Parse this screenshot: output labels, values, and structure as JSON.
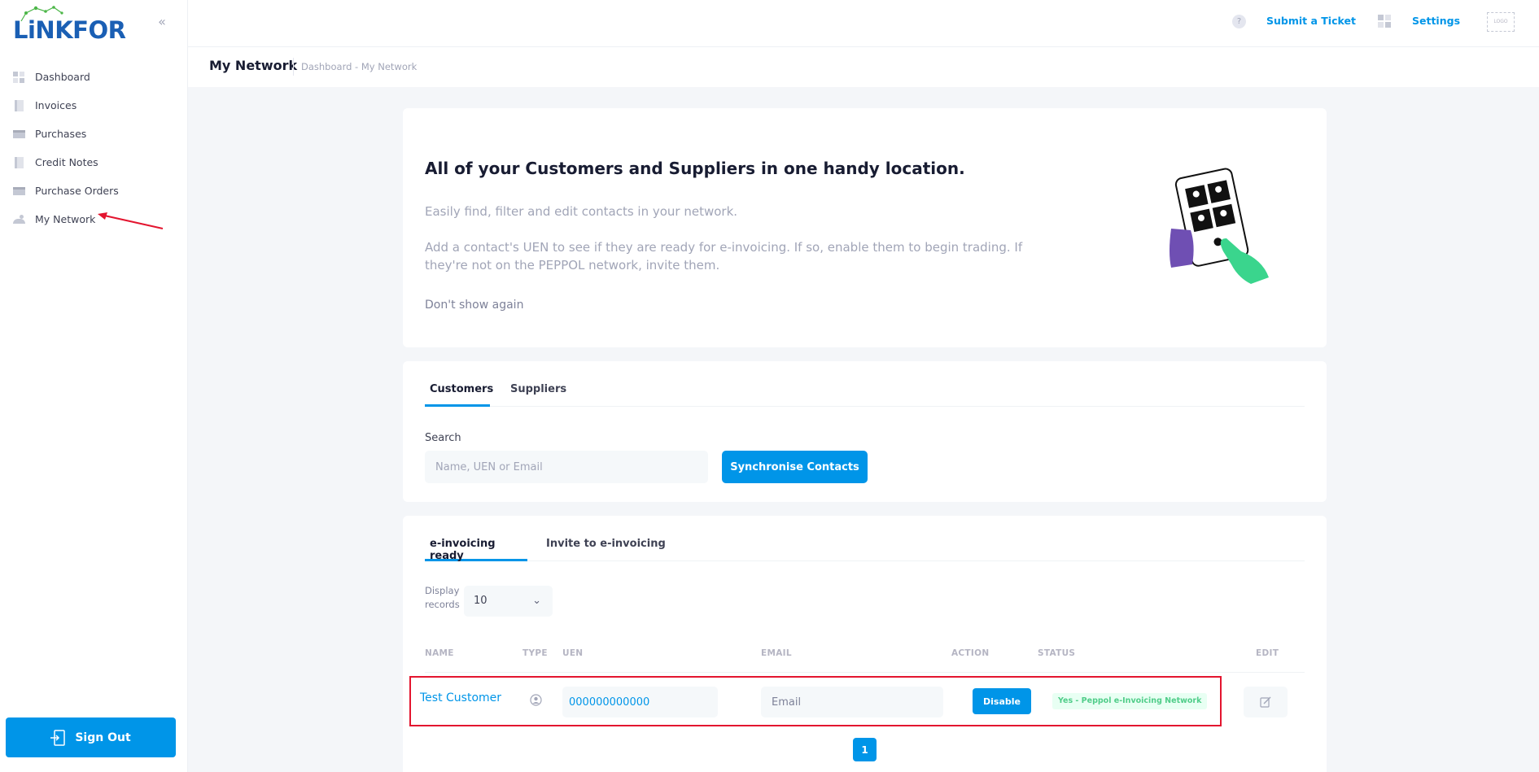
{
  "app": {
    "logo_text": "LiNKFOR"
  },
  "sidebar": {
    "collapse_glyph": "«",
    "items": [
      {
        "label": "Dashboard",
        "icon": "dashboard-icon"
      },
      {
        "label": "Invoices",
        "icon": "invoices-icon"
      },
      {
        "label": "Purchases",
        "icon": "purchases-icon"
      },
      {
        "label": "Credit Notes",
        "icon": "credit-notes-icon"
      },
      {
        "label": "Purchase Orders",
        "icon": "purchase-orders-icon"
      },
      {
        "label": "My Network",
        "icon": "network-icon"
      }
    ],
    "sign_out_label": "Sign Out"
  },
  "header": {
    "help_glyph": "?",
    "submit_ticket_label": "Submit a Ticket",
    "settings_label": "Settings",
    "logo_placeholder": "LOGO"
  },
  "subheader": {
    "title": "My Network",
    "breadcrumb": "Dashboard - My Network"
  },
  "hero": {
    "title": "All of your Customers and Suppliers in one handy location.",
    "paragraph_1": "Easily find, filter and edit contacts in your network.",
    "paragraph_2": "Add a contact's UEN to see if they are ready for e-invoicing. If so, enable them to begin trading. If they're not on the PEPPOL network, invite them.",
    "dismiss_label": "Don't show again"
  },
  "contacts": {
    "tabs": [
      {
        "label": "Customers",
        "active": true
      },
      {
        "label": "Suppliers",
        "active": false
      }
    ],
    "search_label": "Search",
    "search_placeholder": "Name, UEN or Email",
    "sync_button_label": "Synchronise Contacts"
  },
  "table": {
    "tabs": [
      {
        "label": "e-invoicing ready",
        "active": true
      },
      {
        "label": "Invite to e-invoicing",
        "active": false
      }
    ],
    "display_label_line1": "Display",
    "display_label_line2": "records",
    "display_value": "10",
    "columns": [
      "NAME",
      "TYPE",
      "UEN",
      "EMAIL",
      "ACTION",
      "STATUS",
      "EDIT"
    ],
    "rows": [
      {
        "name": "Test Customer",
        "type_icon": "person-icon",
        "uen": "000000000000",
        "email_placeholder": "Email",
        "action_label": "Disable",
        "status": "Yes - Peppol e-Invoicing Network"
      }
    ],
    "current_page": "1"
  },
  "colors": {
    "accent": "#0095e8",
    "logo_blue": "#1a5fb4",
    "highlight_red": "#e3152f",
    "status_green": "#50cd89"
  }
}
